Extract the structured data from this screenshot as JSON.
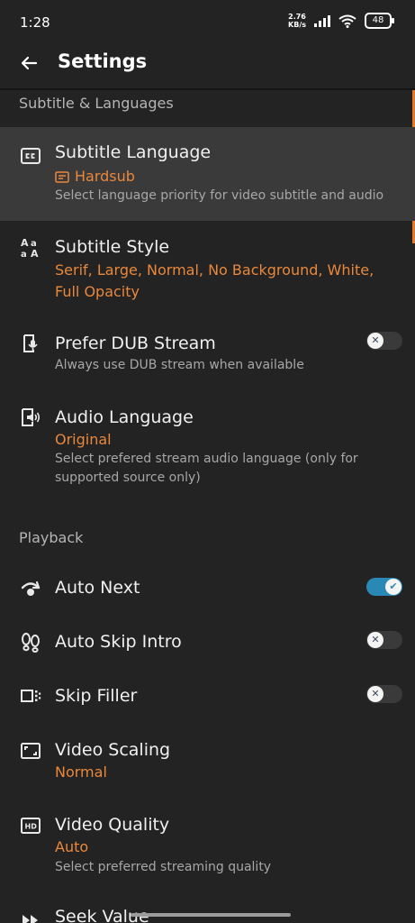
{
  "status": {
    "time": "1:28",
    "netspeed_value": "2.76",
    "netspeed_unit": "KB/s",
    "battery": "48"
  },
  "appbar": {
    "title": "Settings"
  },
  "sections": {
    "subtitle": "Subtitle & Languages",
    "playback": "Playback"
  },
  "items": {
    "subtitle_language": {
      "title": "Subtitle Language",
      "value": "Hardsub",
      "desc": "Select language priority for video subtitle and audio"
    },
    "subtitle_style": {
      "title": "Subtitle Style",
      "value": "Serif, Large, Normal, No Background, White, Full Opacity"
    },
    "prefer_dub": {
      "title": "Prefer DUB Stream",
      "desc": "Always use DUB stream when available",
      "enabled": false
    },
    "audio_language": {
      "title": "Audio Language",
      "value": "Original",
      "desc": "Select prefered stream audio language (only for supported source only)"
    },
    "auto_next": {
      "title": "Auto Next",
      "enabled": true
    },
    "auto_skip_intro": {
      "title": "Auto Skip Intro",
      "enabled": false
    },
    "skip_filler": {
      "title": "Skip Filler",
      "enabled": false
    },
    "video_scaling": {
      "title": "Video Scaling",
      "value": "Normal"
    },
    "video_quality": {
      "title": "Video Quality",
      "value": "Auto",
      "desc": "Select preferred streaming quality"
    },
    "seek_value": {
      "title": "Seek Value"
    }
  },
  "colors": {
    "background": "#232323",
    "highlight": "#3a3a3a",
    "accent": "#e9883c",
    "toggle_on": "#2a88b5"
  },
  "icons": {
    "subtitle_language": "closed-caption-icon",
    "subtitle_style": "font-style-icon",
    "prefer_dub": "voice-document-icon",
    "audio_language": "speaker-document-icon",
    "auto_next": "skip-next-icon",
    "auto_skip_intro": "footprints-icon",
    "skip_filler": "skip-filler-icon",
    "video_scaling": "aspect-ratio-icon",
    "video_quality": "hd-icon",
    "seek_value": "fast-forward-icon"
  }
}
